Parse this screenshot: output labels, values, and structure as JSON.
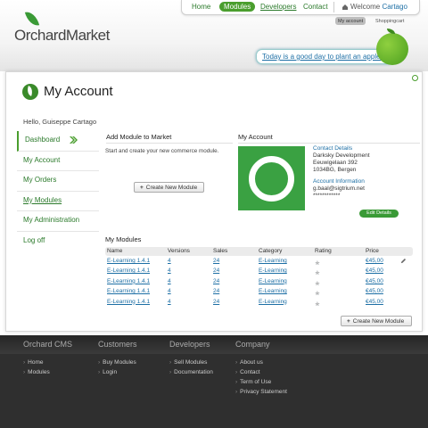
{
  "brand": {
    "name": "OrchardMarket"
  },
  "topnav": {
    "items": [
      "Home",
      "Modules",
      "Developers",
      "Contact"
    ],
    "welcome_prefix": "Welcome",
    "user": "Cartago"
  },
  "subnav": {
    "account": "My account",
    "cart": "Shoppingcart"
  },
  "tagline": "Today is a good day to plant an appletree.",
  "page": {
    "title": "My Account",
    "greeting": "Hello, Guiseppe Cartago"
  },
  "sidebar": {
    "items": [
      {
        "label": "Dashboard"
      },
      {
        "label": "My Account"
      },
      {
        "label": "My Orders"
      },
      {
        "label": "My Modules"
      },
      {
        "label": "My Administration"
      },
      {
        "label": "Log off"
      }
    ]
  },
  "add_module": {
    "heading": "Add Module to Market",
    "text": "Start and create your new commerce module.",
    "button": "Create New Module"
  },
  "account": {
    "heading": "My Account",
    "contact_heading": "Contact Details",
    "contact_lines": [
      "Darksky Development",
      "Eeuwigelaan 392",
      "1034BG, Bergen"
    ],
    "info_heading": "Account Information",
    "email": "g.baal@sigtrium.net",
    "password": "************",
    "edit_button": "Edit Details"
  },
  "modules": {
    "title": "My Modules",
    "columns": [
      "Name",
      "Versions",
      "Sales",
      "Category",
      "Rating",
      "Price"
    ],
    "rows": [
      {
        "name": "E-Learning 1.4.1",
        "versions": "4",
        "sales": "24",
        "category": "E-Learning",
        "rating": 1,
        "price": "€45,00"
      },
      {
        "name": "E-Learning 1.4.1",
        "versions": "4",
        "sales": "24",
        "category": "E-Learning",
        "rating": 1,
        "price": "€45,00"
      },
      {
        "name": "E-Learning 1.4.1",
        "versions": "4",
        "sales": "24",
        "category": "E-Learning",
        "rating": 1,
        "price": "€45,00"
      },
      {
        "name": "E-Learning 1.4.1",
        "versions": "4",
        "sales": "24",
        "category": "E-Learning",
        "rating": 1,
        "price": "€45,00"
      },
      {
        "name": "E-Learning 1.4.1",
        "versions": "4",
        "sales": "24",
        "category": "E-Learning",
        "rating": 1,
        "price": "€45,00"
      }
    ],
    "rating_max": 5,
    "create_button": "Create New Module"
  },
  "footer": {
    "columns": [
      {
        "heading": "Orchard CMS",
        "links": [
          "Home",
          "Modules"
        ]
      },
      {
        "heading": "Customers",
        "links": [
          "Buy Modules",
          "Login"
        ]
      },
      {
        "heading": "Developers",
        "links": [
          "Sell Modules",
          "Documentation"
        ]
      },
      {
        "heading": "Company",
        "links": [
          "About us",
          "Contact",
          "Term of Use",
          "Privacy Statement"
        ]
      }
    ]
  },
  "colors": {
    "green": "#4a9e2e",
    "link": "#1d6fa5",
    "footer_bg": "#2f2f2f"
  }
}
